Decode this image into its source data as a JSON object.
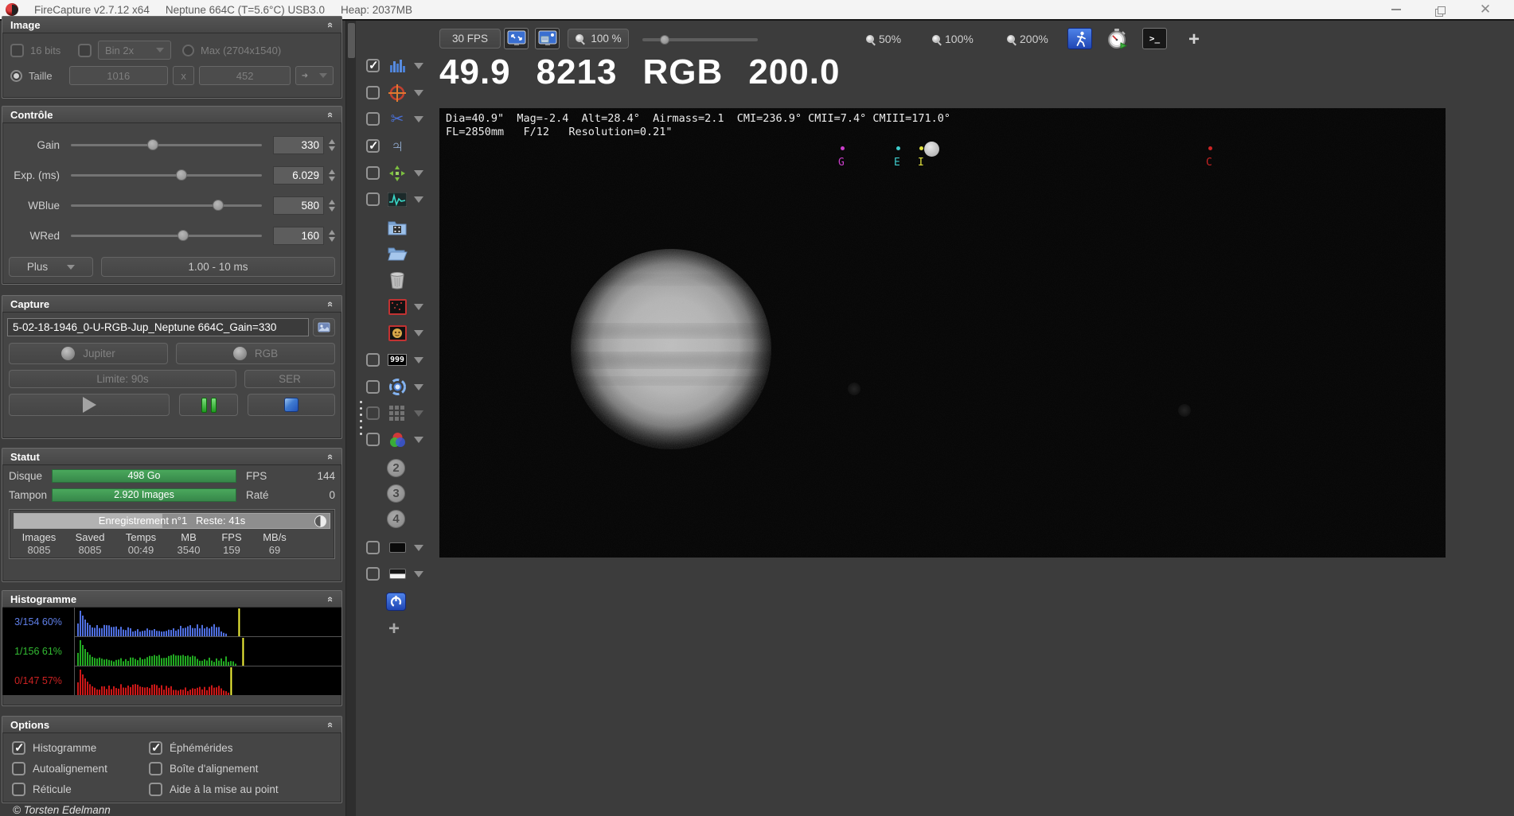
{
  "window": {
    "app_title": "FireCapture v2.7.12 x64",
    "camera_title": "Neptune 664C (T=5.6°C) USB3.0",
    "heap": "Heap: 2037MB"
  },
  "image_section": {
    "title": "Image",
    "bits_label": "16 bits",
    "bin_label": "Bin 2x",
    "max_label": "Max (2704x1540)",
    "taille_label": "Taille",
    "width_value": "1016",
    "x_label": "x",
    "height_value": "452"
  },
  "controle": {
    "title": "Contrôle",
    "rows": [
      {
        "label": "Gain",
        "value": "330",
        "pos": 40
      },
      {
        "label": "Exp. (ms)",
        "value": "6.029",
        "pos": 55
      },
      {
        "label": "WBlue",
        "value": "580",
        "pos": 74
      },
      {
        "label": "WRed",
        "value": "160",
        "pos": 56
      }
    ],
    "plus_label": "Plus",
    "range_label": "1.00 - 10 ms"
  },
  "capture": {
    "title": "Capture",
    "filename": "5-02-18-1946_0-U-RGB-Jup_Neptune 664C_Gain=330",
    "target_label": "Jupiter",
    "filter_label": "RGB",
    "limit_label": "Limite: 90s",
    "format_label": "SER"
  },
  "statut": {
    "title": "Statut",
    "disque_label": "Disque",
    "disque_value": "498 Go",
    "fps_label": "FPS",
    "fps_value": "144",
    "tampon_label": "Tampon",
    "tampon_value": "2.920 Images",
    "rate_label": "Raté",
    "rate_value": "0",
    "rec_label": "Enregistrement n°1",
    "reste_label": "Reste: 41s",
    "cols": [
      "Images",
      "Saved",
      "Temps",
      "MB",
      "FPS",
      "MB/s"
    ],
    "vals": [
      "8085",
      "8085",
      "00:49",
      "3540",
      "159",
      "69"
    ]
  },
  "histogramme": {
    "title": "Histogramme",
    "channels": [
      {
        "label": "3/154 60%",
        "color": "#4f6fe0",
        "text_color": "#5f7fe8",
        "bars_end_pct": 57,
        "line_pct": 61.5
      },
      {
        "label": "1/156 61%",
        "color": "#22aa22",
        "text_color": "#33bb33",
        "bars_end_pct": 61,
        "line_pct": 63
      },
      {
        "label": "0/147 57%",
        "color": "#cc1818",
        "text_color": "#cc2222",
        "bars_end_pct": 57.5,
        "line_pct": 58.5
      }
    ]
  },
  "options": {
    "title": "Options",
    "items": [
      {
        "label": "Histogramme",
        "checked": true
      },
      {
        "label": "Éphémérides",
        "checked": true
      },
      {
        "label": "Autoalignement",
        "checked": false
      },
      {
        "label": "Boîte d'alignement",
        "checked": false
      },
      {
        "label": "Réticule",
        "checked": false
      },
      {
        "label": "Aide à la mise au point",
        "checked": false
      }
    ]
  },
  "copyright": "© Torsten Edelmann",
  "toolbar": {
    "fps_button": "30 FPS",
    "zoom_display": "100 %",
    "zoom_50": "50%",
    "zoom_100": "100%",
    "zoom_200": "200%"
  },
  "display": {
    "stats": [
      "49.9",
      "8213",
      "RGB",
      "200.0"
    ],
    "info_line1": "Dia=40.9\"  Mag=-2.4  Alt=28.4°  Airmass=2.1  CMI=236.9° CMII=7.4° CMIII=171.0°",
    "info_line2": "FL=2850mm   F/12   Resolution=0.21\"",
    "moons": [
      {
        "label": "G",
        "color": "#cc3ecc"
      },
      {
        "label": "E",
        "color": "#3ecccc"
      },
      {
        "label": "I",
        "color": "#e0e03e"
      },
      {
        "label": "C",
        "color": "#cc2424"
      }
    ]
  }
}
